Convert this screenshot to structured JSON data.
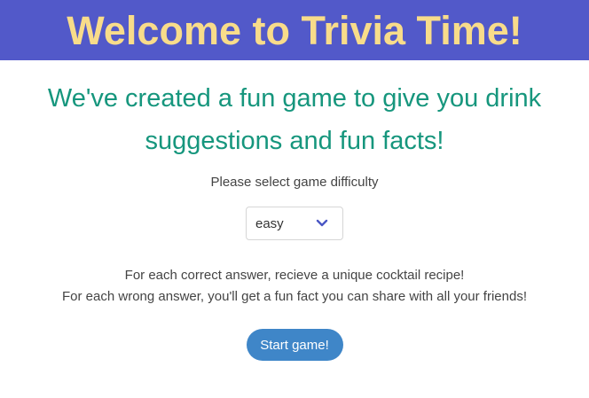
{
  "header": {
    "title": "Welcome to Trivia Time!"
  },
  "intro": {
    "text": "We've created a fun game to give you drink suggestions and fun facts!"
  },
  "difficulty": {
    "prompt": "Please select game difficulty",
    "selected": "easy",
    "icon": "chevron-down-icon"
  },
  "rules": {
    "correct": "For each correct answer, recieve a unique cocktail recipe!",
    "wrong": "For each wrong answer, you'll get a fun fact you can share with all your friends!"
  },
  "start_button": {
    "label": "Start game!"
  },
  "colors": {
    "header_bg": "#5259c9",
    "title_text": "#f8dc8a",
    "intro_text": "#16967d",
    "button_bg": "#3f86c8",
    "chevron": "#4a56c4"
  }
}
